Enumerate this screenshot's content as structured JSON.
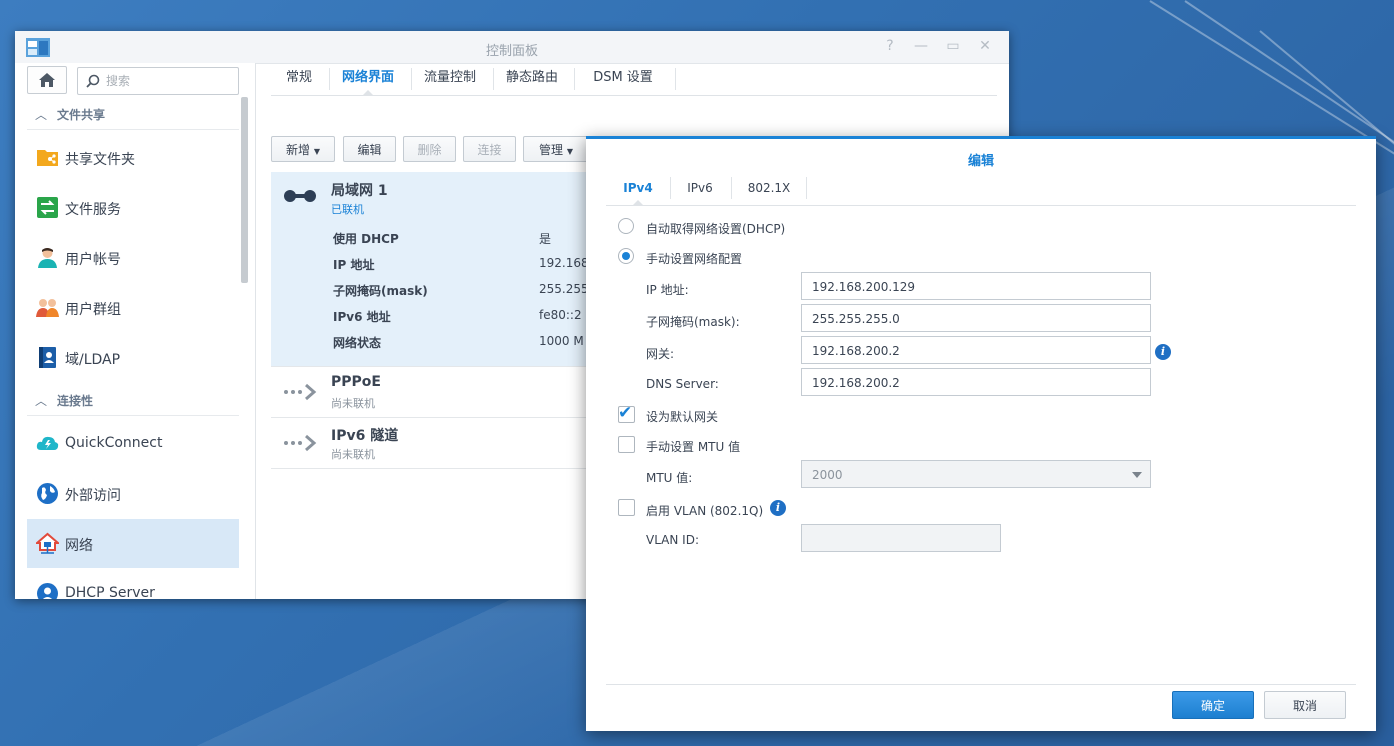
{
  "window": {
    "title": "控制面板"
  },
  "search": {
    "placeholder": "搜索"
  },
  "sidebar": {
    "sections": [
      {
        "label": "文件共享"
      },
      {
        "label": "连接性"
      }
    ],
    "items": [
      {
        "label": "共享文件夹"
      },
      {
        "label": "文件服务"
      },
      {
        "label": "用户帐号"
      },
      {
        "label": "用户群组"
      },
      {
        "label": "域/LDAP"
      },
      {
        "label": "QuickConnect"
      },
      {
        "label": "外部访问"
      },
      {
        "label": "网络"
      },
      {
        "label": "DHCP Server"
      }
    ],
    "active_item": "网络"
  },
  "tabs": [
    {
      "label": "常规"
    },
    {
      "label": "网络界面"
    },
    {
      "label": "流量控制"
    },
    {
      "label": "静态路由"
    },
    {
      "label": "DSM 设置"
    }
  ],
  "toolbar": {
    "create": "新增",
    "edit": "编辑",
    "delete": "删除",
    "connect": "连接",
    "manage": "管理"
  },
  "interfaces": [
    {
      "name": "局域网 1",
      "status": "已联机",
      "details": [
        {
          "key": "使用 DHCP",
          "value": "是"
        },
        {
          "key": "IP 地址",
          "value": "192.168"
        },
        {
          "key": "子网掩码(mask)",
          "value": "255.255"
        },
        {
          "key": "IPv6 地址",
          "value": "fe80::2"
        },
        {
          "key": "网络状态",
          "value": "1000 M"
        }
      ]
    },
    {
      "name": "PPPoE",
      "status": "尚未联机"
    },
    {
      "name": "IPv6 隧道",
      "status": "尚未联机"
    }
  ],
  "dialog": {
    "title": "编辑",
    "tabs": [
      {
        "label": "IPv4"
      },
      {
        "label": "IPv6"
      },
      {
        "label": "802.1X"
      }
    ],
    "dhcp_option": "自动取得网络设置(DHCP)",
    "manual_option": "手动设置网络配置",
    "ip_label": "IP 地址:",
    "ip_value": "192.168.200.129",
    "mask_label": "子网掩码(mask):",
    "mask_value": "255.255.255.0",
    "gateway_label": "网关:",
    "gateway_value": "192.168.200.2",
    "dns_label": "DNS Server:",
    "dns_value": "192.168.200.2",
    "default_gateway_label": "设为默认网关",
    "manual_mtu_label": "手动设置 MTU 值",
    "mtu_label": "MTU 值:",
    "mtu_value": "2000",
    "vlan_label": "启用 VLAN (802.1Q)",
    "vlan_id_label": "VLAN ID:",
    "vlan_id_value": "",
    "ok": "确定",
    "cancel": "取消"
  }
}
